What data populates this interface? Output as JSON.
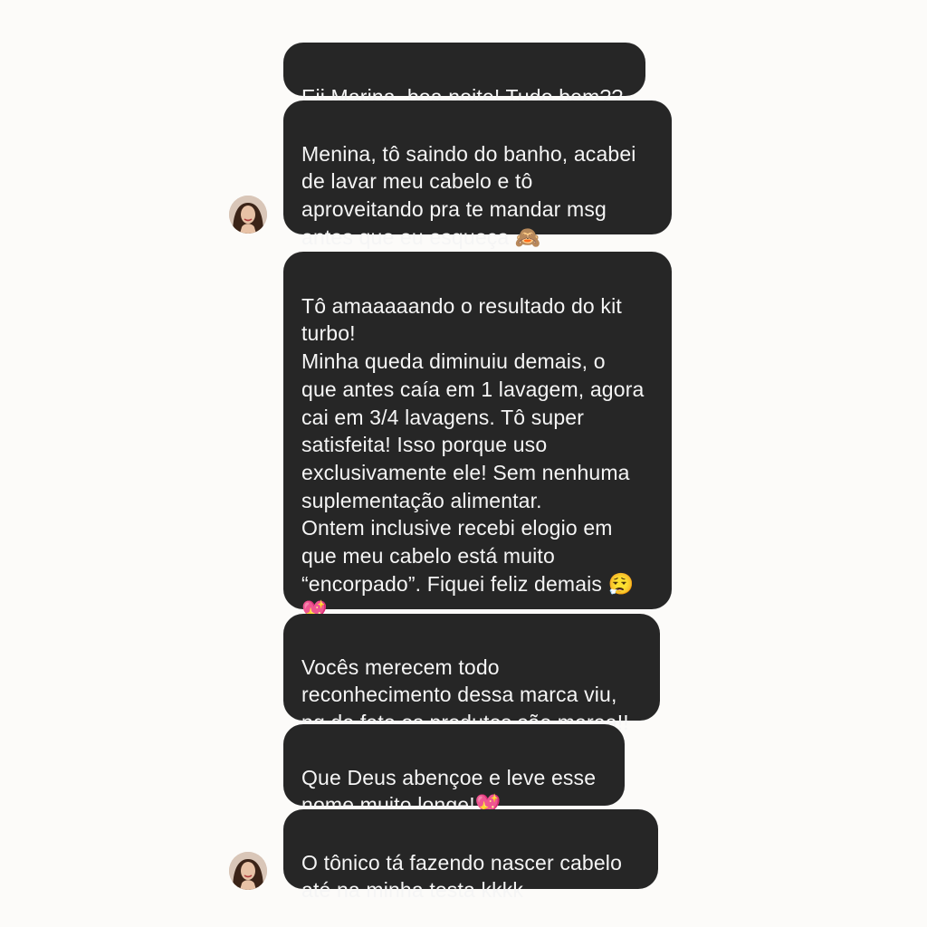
{
  "conversation": {
    "messages": [
      {
        "text": "Eii Marina, boa noite! Tudo bem??"
      },
      {
        "text": "Menina, tô saindo do banho, acabei\nde lavar meu cabelo e tô\naproveitando pra te mandar msg\nantes que eu esqueça 🙈"
      },
      {
        "text": "Tô amaaaaando o resultado do kit\nturbo!\nMinha queda diminuiu demais, o\nque antes caía em 1 lavagem, agora\ncai em 3/4 lavagens. Tô super\nsatisfeita! Isso porque uso\nexclusivamente ele! Sem nenhuma\nsuplementação alimentar.\nOntem inclusive recebi elogio em\nque meu cabelo está muito\n“encorpado”. Fiquei feliz demais 😮‍💨\n💖"
      },
      {
        "text": "Vocês merecem todo\nreconhecimento dessa marca viu,\npq de fato os produtos são maraa!!"
      },
      {
        "text": "Que Deus abençoe e leve esse\nnome muito longe!💖"
      },
      {
        "text": "O tônico tá fazendo nascer cabelo\naté na minha testa kkkk"
      }
    ]
  },
  "colors": {
    "background": "#fcfbf9",
    "bubble": "#262626",
    "bubble_text": "#f5f5f5"
  }
}
